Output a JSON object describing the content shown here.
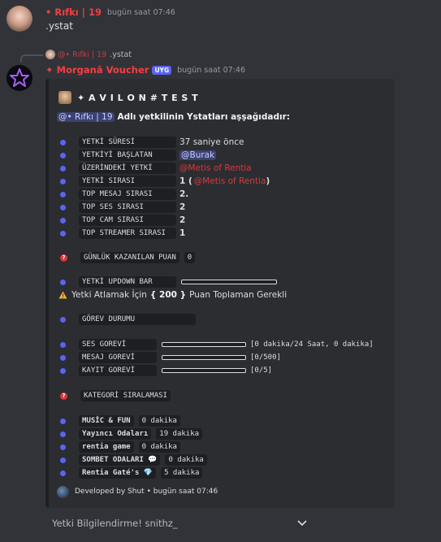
{
  "msg1": {
    "author": "• Rıfkı | 19",
    "timestamp": "bugün saat 07:46",
    "content": ".ystat"
  },
  "reply": {
    "author": "@• Rıfkı | 19",
    "content": ".ystat"
  },
  "msg2": {
    "author": "✦ Morganâ Voucher",
    "badge": "UYG",
    "timestamp": "bugün saat 07:46"
  },
  "embed": {
    "title": "✦ A V I L O N # T E S T",
    "intro_mention": "@• Rıfkı | 19",
    "intro_text": "Adlı yetkilinin Ystatları aşşağıdadır:",
    "stats": [
      {
        "label": "YETKİ SÜRESİ",
        "value": "37 saniye önce"
      },
      {
        "label": "YETKİYİ BAŞLATAN",
        "value": "@Burak"
      },
      {
        "label": "ÜZERİNDEKİ YETKİ",
        "value": "@Metis of Rentia"
      },
      {
        "label": "YETKİ SIRASI",
        "value_prefix": "1 (",
        "value_mention": "@Metis of Rentia",
        "value_suffix": ")"
      },
      {
        "label": "TOP MESAJ SIRASI",
        "value": "2."
      },
      {
        "label": "TOP SES SIRASI",
        "value": "2"
      },
      {
        "label": "TOP CAM SIRASI",
        "value": "2"
      },
      {
        "label": "TOP STREAMER SIRASI",
        "value": "1"
      }
    ],
    "daily_label": "GÜNLÜK KAZANILAN PUAN",
    "daily_value": "0",
    "updown_label": "YETKİ UPDOWN BAR",
    "updown_progress": 0,
    "warning_text_a": "Yetki Atlamak İçin",
    "warning_value": "{ 200 }",
    "warning_text_b": "Puan Toplaman Gerekli",
    "task_header": "GÖREV DURUMU",
    "tasks": [
      {
        "label": "SES GOREVİ",
        "progress": 0,
        "status": "[0 dakika/24 Saat, 0 dakika]"
      },
      {
        "label": "MESAJ GOREVİ",
        "progress": 0,
        "status": "[0/500]"
      },
      {
        "label": "KAYIT GOREVİ",
        "progress": 0,
        "status": "[0/5]"
      }
    ],
    "category_header": "KATEGORİ SIRALAMASI",
    "categories": [
      {
        "name": "MUSİC & FUN",
        "value": "0 dakika"
      },
      {
        "name": "Yayıncı Odaları",
        "value": "19 dakika"
      },
      {
        "name": "rentia game",
        "value": "0 dakika"
      },
      {
        "name": "SOMBET ODALARI 💬",
        "value": "0 dakika"
      },
      {
        "name": "Rentia Gaté's 💎",
        "value": "5 dakika"
      }
    ],
    "footer": "Developed by Shut • bugün saat 07:46"
  },
  "select": {
    "placeholder": "Yetki Bilgilendirme! snithz_"
  },
  "colors": {
    "background": "#313338",
    "embed_bg": "#2b2d31",
    "accent_red": "#da373c",
    "bullet_blue": "#5865f2",
    "author_red": "#f23f43"
  }
}
